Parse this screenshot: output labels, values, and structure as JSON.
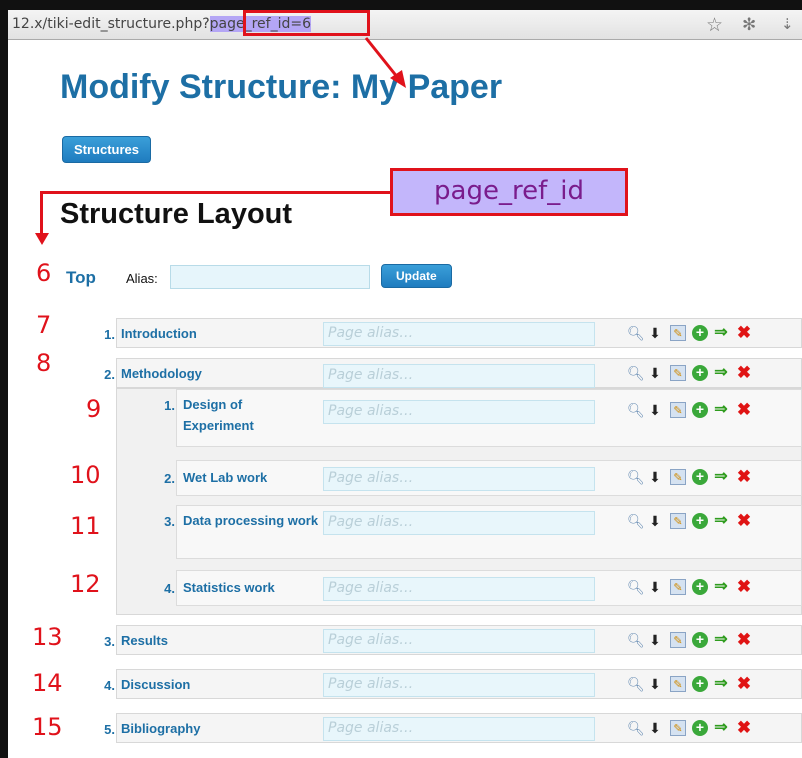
{
  "browser": {
    "url_prefix": "12.x/tiki-edit_structure.php?",
    "url_highlight": "page_ref_id=6",
    "star_icon": "star-icon",
    "bug_icon": "firebug-icon"
  },
  "page": {
    "title": "Modify Structure: My Paper",
    "structures_button": "Structures",
    "layout_heading": "Structure Layout",
    "callout": "page_ref_id",
    "top": {
      "id": "6",
      "label": "Top",
      "alias_label": "Alias:",
      "alias_value": "",
      "update_button": "Update"
    },
    "alias_placeholder": "Page alias…",
    "nodes": [
      {
        "id": "7",
        "num": "1.",
        "label": "Introduction"
      },
      {
        "id": "8",
        "num": "2.",
        "label": "Methodology"
      },
      {
        "id": "9",
        "num": "1.",
        "label": "Design of Experiment"
      },
      {
        "id": "10",
        "num": "2.",
        "label": "Wet Lab work"
      },
      {
        "id": "11",
        "num": "3.",
        "label": "Data processing work"
      },
      {
        "id": "12",
        "num": "4.",
        "label": "Statistics work"
      },
      {
        "id": "13",
        "num": "3.",
        "label": "Results"
      },
      {
        "id": "14",
        "num": "4.",
        "label": "Discussion"
      },
      {
        "id": "15",
        "num": "5.",
        "label": "Bibliography"
      }
    ]
  },
  "colors": {
    "link": "#1d6fa5",
    "annotation": "#e0121b",
    "callout_bg": "#c3b6fb"
  }
}
